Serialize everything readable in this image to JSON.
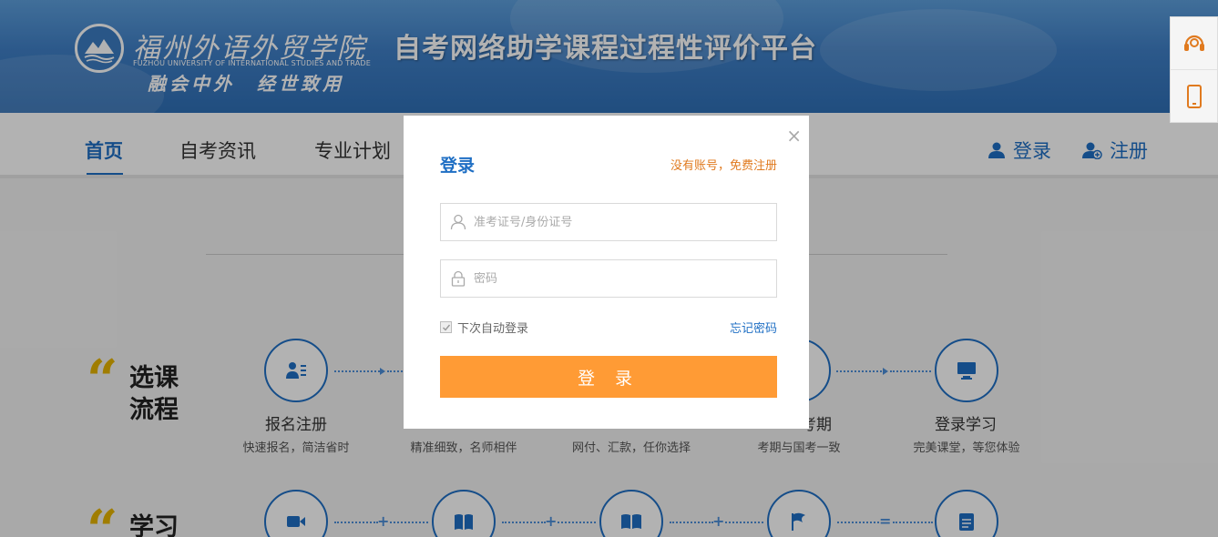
{
  "header": {
    "school_name_cn": "福州外语外贸学院",
    "school_name_en": "FUZHOU UNIVERSITY OF INTERNATIONAL STUDIES AND TRADE",
    "platform_title": "自考网络助学课程过程性评价平台",
    "slogan": "融会中外　经世致用"
  },
  "nav": {
    "items": [
      {
        "label": "首页",
        "active": true
      },
      {
        "label": "自考资讯",
        "active": false
      },
      {
        "label": "专业计划",
        "active": false
      }
    ],
    "login_label": "登录",
    "register_label": "注册"
  },
  "sections": {
    "course_flow": {
      "title_line1": "选课",
      "title_line2": "流程",
      "steps": [
        {
          "name": "报名注册",
          "desc": "快速报名，简洁省时",
          "icon": "user-card-icon"
        },
        {
          "name": "",
          "desc": "精准细致，名师相伴",
          "icon": "book-icon"
        },
        {
          "name": "",
          "desc": "网付、汇款，任你选择",
          "icon": "payment-icon"
        },
        {
          "name": "考期",
          "desc": "考期与国考一致",
          "icon": "calendar-icon"
        },
        {
          "name": "登录学习",
          "desc": "完美课堂，等您体验",
          "icon": "monitor-icon"
        }
      ]
    },
    "study": {
      "title_line1": "学习",
      "icons": [
        "video-icon",
        "book-open-icon",
        "reading-icon",
        "flag-icon",
        "score-icon"
      ],
      "operators": [
        "+",
        "+",
        "+",
        "="
      ]
    }
  },
  "modal": {
    "title": "登录",
    "register_link": "没有账号，免费注册",
    "username_placeholder": "准考证号/身份证号",
    "password_placeholder": "密码",
    "remember_label": "下次自动登录",
    "forgot_label": "忘记密码",
    "login_button": "登 录",
    "close_symbol": "×"
  },
  "colors": {
    "primary": "#1f6fc4",
    "accent_orange": "#ff9b35",
    "link_orange": "#e07a1f",
    "quote_gold": "#e6b400"
  }
}
